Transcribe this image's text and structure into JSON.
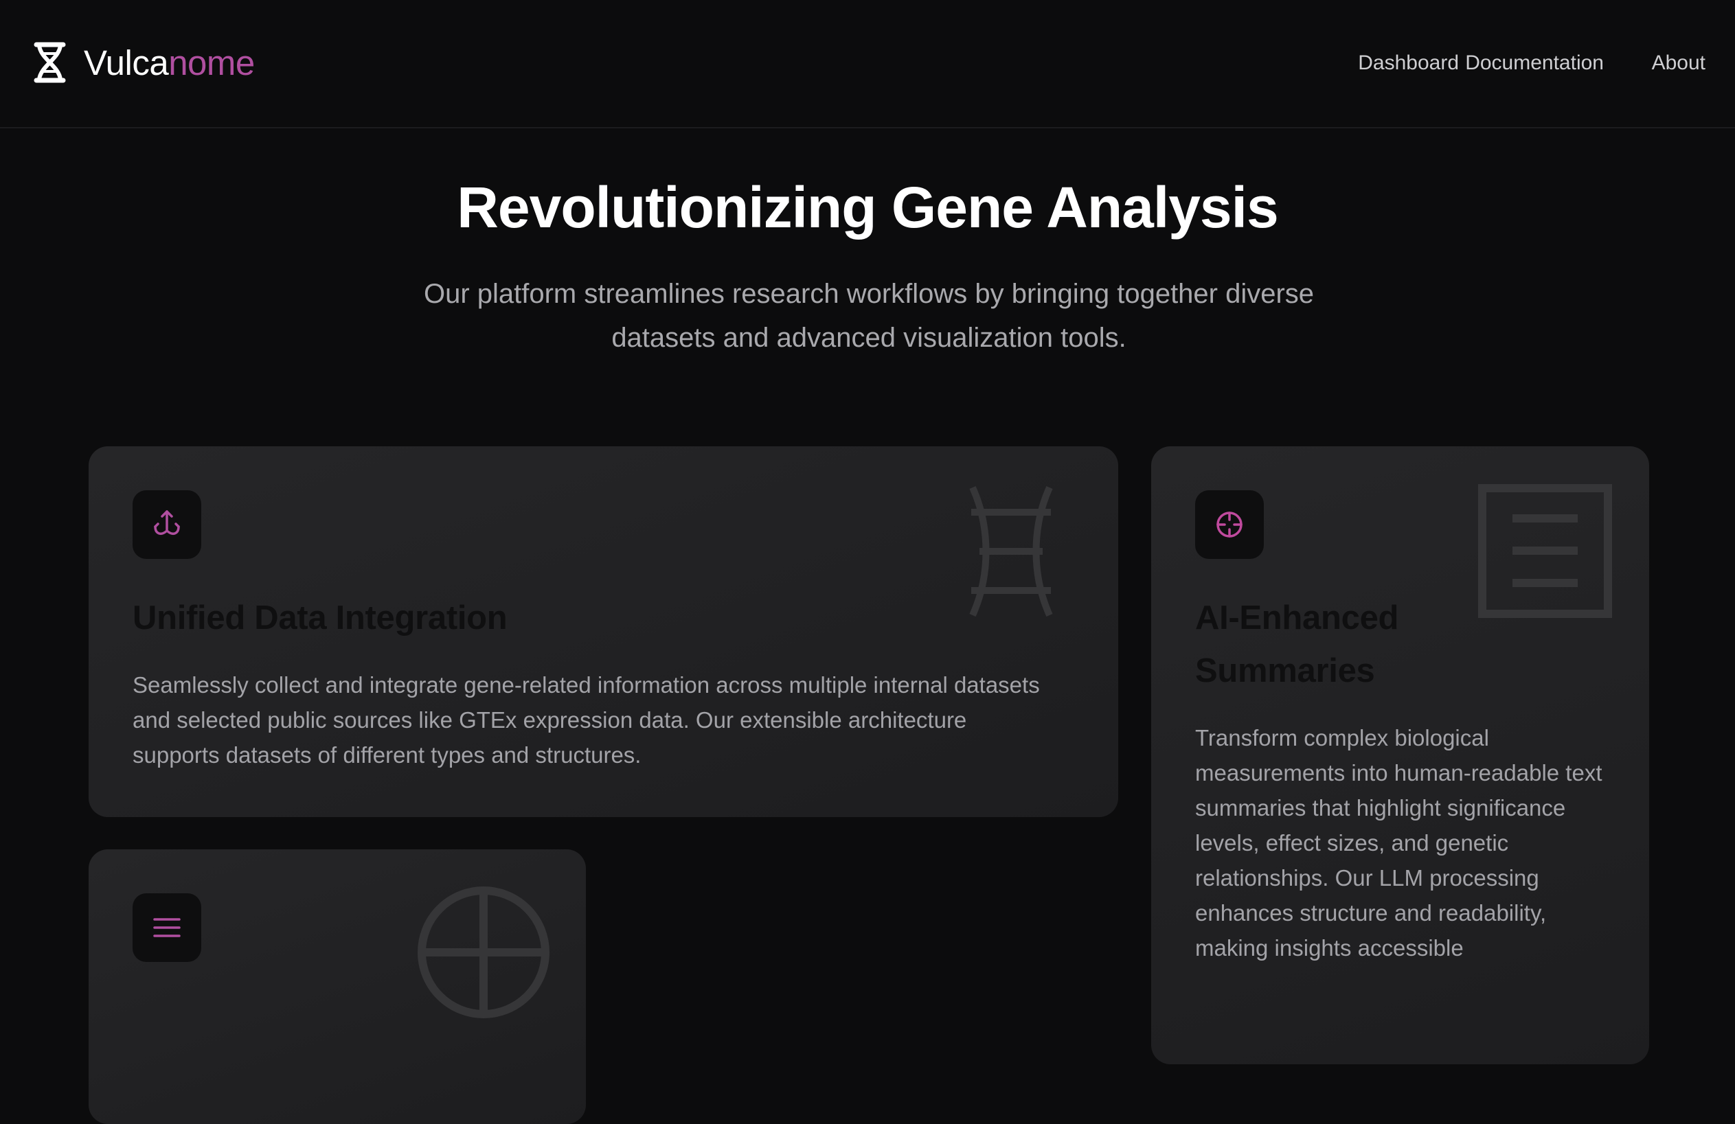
{
  "brand": {
    "name_part1": "Vulca",
    "name_part2": "nome",
    "logo_icon": "dna-helix-icon",
    "accent_color": "#b04fa0"
  },
  "nav": {
    "links": [
      "Dashboard",
      "Documentation",
      "About"
    ]
  },
  "hero": {
    "title": "Revolutionizing Gene Analysis",
    "subtitle": "Our platform streamlines research workflows by bringing together diverse datasets and advanced visualization tools."
  },
  "features": [
    {
      "icon": "download-merge-icon",
      "decor": "ladder-outline-icon",
      "title": "Unified Data Integration",
      "body": "Seamlessly collect and integrate gene-related information across multiple internal datasets and selected public sources like GTEx expression data. Our extensible architecture supports datasets of different types and structures."
    },
    {
      "icon": "crosshair-icon",
      "decor": "document-lines-icon",
      "title": "AI-Enhanced Summaries",
      "body": "Transform complex biological measurements into human-readable text summaries that highlight significance levels, effect sizes, and genetic relationships. Our LLM processing enhances structure and readability, making insights accessible"
    },
    {
      "icon": "menu-lines-icon",
      "decor": "globe-outline-icon"
    }
  ]
}
